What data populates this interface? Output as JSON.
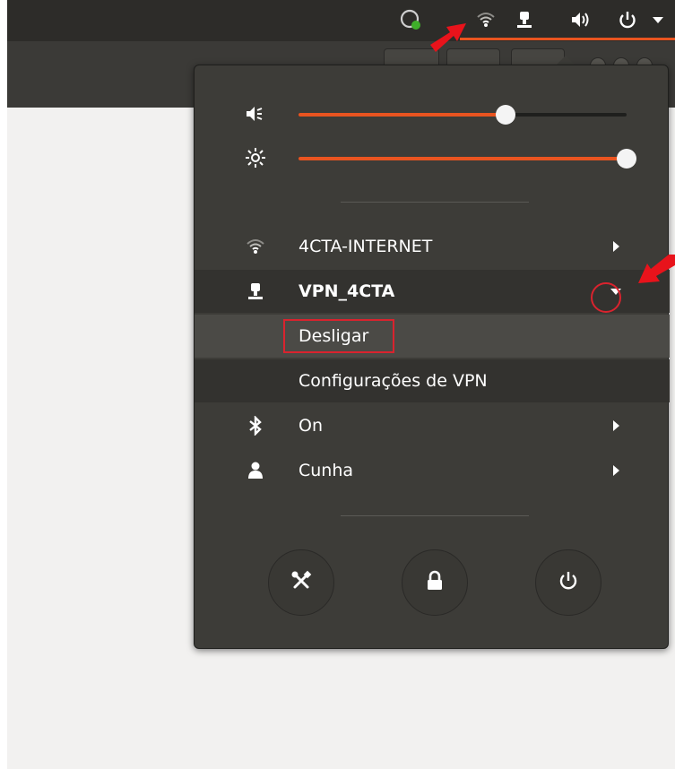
{
  "colors": {
    "accent": "#e95420",
    "annotation_red": "#d9232e",
    "menu_bg": "#3d3c38",
    "panel_bg": "#2d2c29"
  },
  "top_panel": {
    "icons": [
      "skype-icon",
      "wifi-icon",
      "vpn-lock-icon",
      "volume-icon",
      "power-icon",
      "chevron-down-icon"
    ]
  },
  "sliders": {
    "volume": {
      "icon": "volume-low-icon",
      "level": 0.63
    },
    "brightness": {
      "icon": "brightness-icon",
      "level": 1.0
    }
  },
  "menu": {
    "wifi": {
      "icon": "wifi-icon",
      "label": "4CTA-INTERNET"
    },
    "vpn": {
      "icon": "vpn-lock-icon",
      "label": "VPN_4CTA",
      "expanded": true
    },
    "vpn_submenu": [
      {
        "label": "Desligar"
      },
      {
        "label": "Configurações de VPN"
      }
    ],
    "bluetooth": {
      "icon": "bluetooth-icon",
      "label": "On"
    },
    "user": {
      "icon": "user-icon",
      "label": "Cunha"
    }
  },
  "bottom_buttons": [
    {
      "name": "settings-button",
      "icon": "tools-icon"
    },
    {
      "name": "lock-button",
      "icon": "lock-icon"
    },
    {
      "name": "power-off-button",
      "icon": "power-icon"
    }
  ]
}
